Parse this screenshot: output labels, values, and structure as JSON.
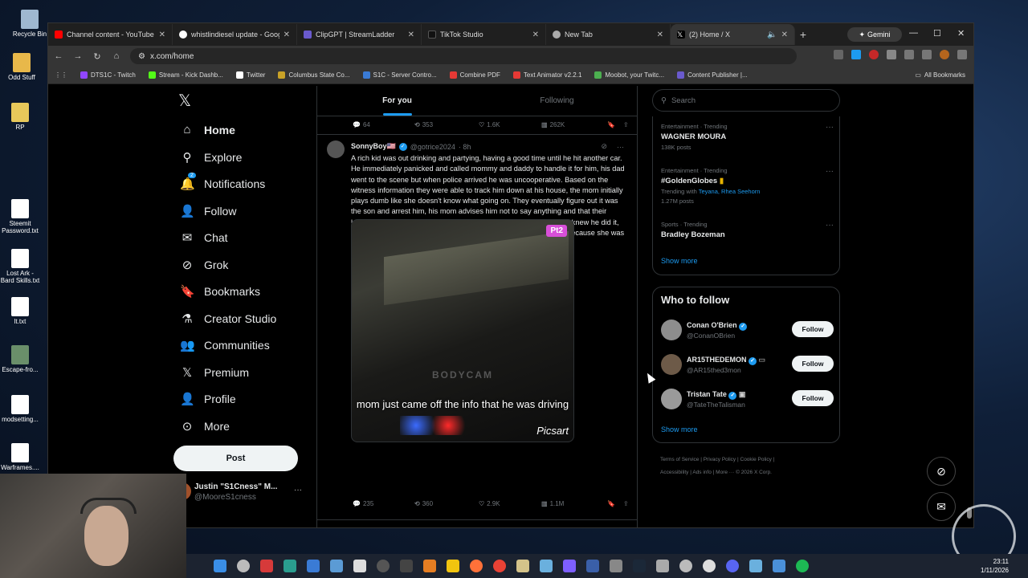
{
  "desktop": {
    "icons": [
      {
        "label": "Recycle Bin",
        "color": "#9fb8d0"
      },
      {
        "label": "Odd Stuff",
        "color": "#e8b84a"
      },
      {
        "label": "RP",
        "color": "#e8c85a"
      },
      {
        "label": "Steemit Password.txt",
        "color": "#ffffff"
      },
      {
        "label": "Lost Ark - Bard Skills.txt",
        "color": "#ffffff"
      },
      {
        "label": "lt.txt",
        "color": "#ffffff"
      },
      {
        "label": "Escape-fro...",
        "color": "#6a8f6a"
      },
      {
        "label": "modsetting...",
        "color": "#ffffff"
      },
      {
        "label": "Warframes....",
        "color": "#ffffff"
      }
    ]
  },
  "browser": {
    "tabs": [
      {
        "title": "Channel content - YouTube St",
        "color": "#ff0000",
        "active": false
      },
      {
        "title": "whistlindiesel update - Googl",
        "color": "#ffffff",
        "active": false
      },
      {
        "title": "ClipGPT | StreamLadder",
        "color": "#6a5acd",
        "active": false
      },
      {
        "title": "TikTok Studio",
        "color": "#111111",
        "active": false
      },
      {
        "title": "New Tab",
        "color": "#aaaaaa",
        "active": false
      },
      {
        "title": "(2) Home / X",
        "color": "#ffffff",
        "active": true
      }
    ],
    "gemini_label": "Gemini",
    "url": "x.com/home",
    "bookmarks": [
      {
        "label": "DTS1C - Twitch",
        "color": "#9146ff"
      },
      {
        "label": "Stream - Kick Dashb...",
        "color": "#53fc18"
      },
      {
        "label": "Twitter",
        "color": "#ffffff"
      },
      {
        "label": "Columbus State Co...",
        "color": "#c9a227"
      },
      {
        "label": "S1C - Server Contro...",
        "color": "#3a7bd5"
      },
      {
        "label": "Combine PDF",
        "color": "#e53935"
      },
      {
        "label": "Text Animator v2.2.1",
        "color": "#e53935"
      },
      {
        "label": "Moobot, your Twitc...",
        "color": "#4caf50"
      },
      {
        "label": "Content Publisher |...",
        "color": "#6a5acd"
      }
    ],
    "all_bookmarks": "All Bookmarks"
  },
  "nav": {
    "logo": "𝕏",
    "items": [
      {
        "label": "Home",
        "icon": "home-icon",
        "glyph": "⌂"
      },
      {
        "label": "Explore",
        "icon": "search-icon",
        "glyph": "⚲"
      },
      {
        "label": "Notifications",
        "icon": "bell-icon",
        "glyph": "🔔"
      },
      {
        "label": "Follow",
        "icon": "person-plus-icon",
        "glyph": "👤"
      },
      {
        "label": "Chat",
        "icon": "mail-icon",
        "glyph": "✉"
      },
      {
        "label": "Grok",
        "icon": "grok-icon",
        "glyph": "⊘"
      },
      {
        "label": "Bookmarks",
        "icon": "bookmark-icon",
        "glyph": "🔖"
      },
      {
        "label": "Creator Studio",
        "icon": "flask-icon",
        "glyph": "⚗"
      },
      {
        "label": "Communities",
        "icon": "people-icon",
        "glyph": "👥"
      },
      {
        "label": "Premium",
        "icon": "x-icon",
        "glyph": "𝕏"
      },
      {
        "label": "Profile",
        "icon": "profile-icon",
        "glyph": "👤"
      },
      {
        "label": "More",
        "icon": "more-icon",
        "glyph": "⊙"
      }
    ],
    "notification_badge": "2",
    "post_label": "Post",
    "account": {
      "name": "Justin \"S1Cness\" M...",
      "handle": "@MooreS1cness"
    }
  },
  "feed": {
    "tabs": [
      "For you",
      "Following"
    ],
    "prev_actions": {
      "replies": "64",
      "reposts": "353",
      "likes": "1.6K",
      "views": "262K"
    },
    "tweet": {
      "name": "SonnyBoy🇺🇸",
      "handle": "@gotrice2024",
      "time": "· 8h",
      "text": "A rich kid was out drinking and partying, having a good time until he hit another car. He immediately panicked and called mommy and daddy to handle it for him, his dad went to the scene but when police arrived he was uncooperative. Based on the witness information they were able to track him down at his house, the mom initially plays dumb like she doesn't know what going on. They eventually figure out it was the son and arrest him, his mom advises him not to say anything and that their lawyer will handle it. Based on the fact she eventually admitted she knew he did it, should the mom be charged too with obstructing, or is that normal because she was only trying to protect her son?",
      "media_badge": "Pt2",
      "media_watermark": "BODYCAM",
      "media_caption": "mom just came off the info that he was driving",
      "media_brand": "Picsart",
      "actions": {
        "replies": "235",
        "reposts": "360",
        "likes": "2.9K",
        "views": "1.1M"
      }
    }
  },
  "sidebar": {
    "search_placeholder": "Search",
    "trends": [
      {
        "category": "Entertainment · Trending",
        "name": "WAGNER MOURA",
        "sub": "138K posts"
      },
      {
        "category": "Entertainment · Trending",
        "name": "#GoldenGlobes",
        "trending_with_label": "Trending with",
        "trending_with": "Teyana, Rhea Seehorn",
        "sub": "1.27M posts"
      },
      {
        "category": "Sports · Trending",
        "name": "Bradley Bozeman"
      }
    ],
    "show_more": "Show more",
    "who_to_follow_title": "Who to follow",
    "suggestions": [
      {
        "name": "Conan O'Brien",
        "handle": "@ConanOBrien",
        "button": "Follow"
      },
      {
        "name": "AR15THEDEMON",
        "handle": "@AR15thed3mon",
        "button": "Follow"
      },
      {
        "name": "Tristan Tate",
        "handle": "@TateTheTalisman",
        "button": "Follow"
      }
    ],
    "footer_links": [
      "Terms of Service",
      "Privacy Policy",
      "Cookie Policy",
      "Accessibility",
      "Ads info",
      "More ···",
      "© 2026 X Corp."
    ]
  },
  "taskbar": {
    "time": "23:11",
    "date": "1/11/2026"
  }
}
